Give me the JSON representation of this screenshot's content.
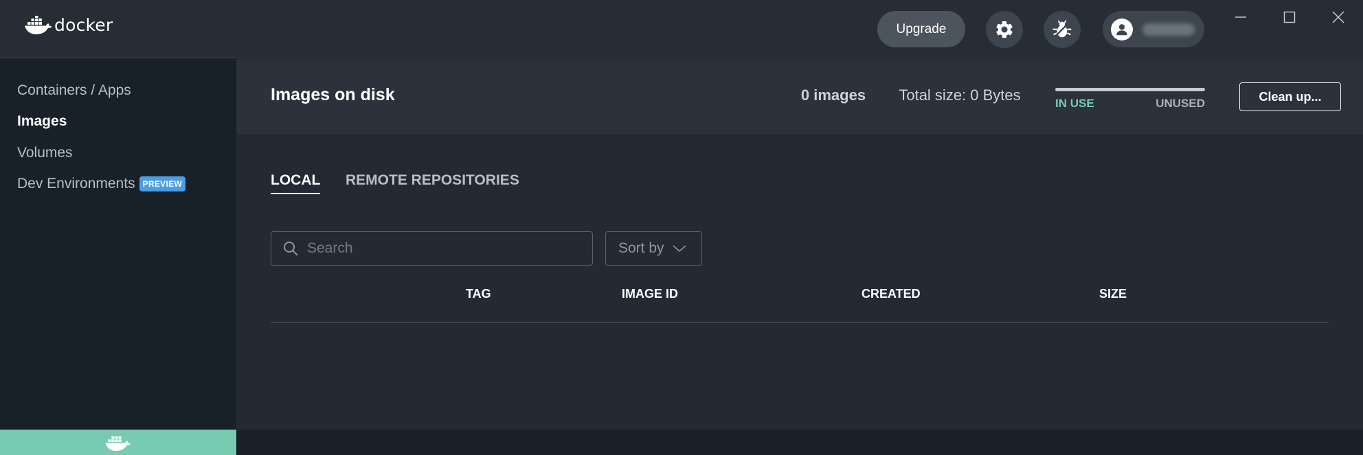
{
  "app": {
    "brand": "docker"
  },
  "titlebar": {
    "upgrade_label": "Upgrade",
    "icons": [
      "gear-icon",
      "bug-icon",
      "account-icon",
      "minimize-icon",
      "maximize-icon",
      "close-icon"
    ]
  },
  "sidebar": {
    "items": [
      {
        "label": "Containers / Apps",
        "active": false
      },
      {
        "label": "Images",
        "active": true
      },
      {
        "label": "Volumes",
        "active": false
      },
      {
        "label": "Dev Environments",
        "active": false,
        "badge": "PREVIEW"
      }
    ]
  },
  "header": {
    "title": "Images on disk",
    "image_count": "0 images",
    "total_size": "Total size: 0 Bytes",
    "usage": {
      "in_use_label": "IN USE",
      "unused_label": "UNUSED",
      "in_use_fraction": 0
    },
    "cleanup_label": "Clean up..."
  },
  "tabs": [
    {
      "label": "LOCAL",
      "active": true
    },
    {
      "label": "REMOTE REPOSITORIES",
      "active": false
    }
  ],
  "search": {
    "placeholder": "Search",
    "value": ""
  },
  "sort": {
    "label": "Sort by"
  },
  "table": {
    "columns": [
      "TAG",
      "IMAGE ID",
      "CREATED",
      "SIZE"
    ],
    "rows": []
  },
  "colors": {
    "accent_green": "#76cbb0",
    "preview_badge": "#4d9de5",
    "titlebar_bg": "#262d35",
    "sidebar_bg": "#18202a"
  }
}
